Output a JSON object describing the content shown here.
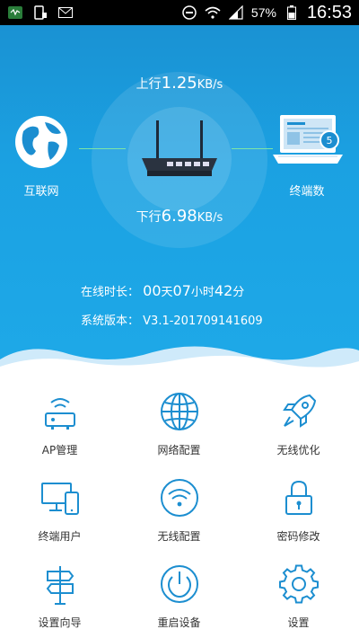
{
  "status_bar": {
    "battery": "57%",
    "time": "16:53"
  },
  "hero": {
    "upload_label": "上行",
    "upload_value": "1.25",
    "upload_unit": "KB/s",
    "download_label": "下行",
    "download_value": "6.98",
    "download_unit": "KB/s",
    "internet_label": "互联网",
    "terminals_label": "终端数",
    "terminals_count": "5",
    "online_label": "在线时长：",
    "online_days": "00",
    "online_days_unit": "天",
    "online_hours": "07",
    "online_hours_unit": "小时",
    "online_minutes": "42",
    "online_minutes_unit": "分",
    "version_label": "系统版本：",
    "version_value": "V3.1-201709141609"
  },
  "menu": {
    "ap": "AP管理",
    "network": "网络配置",
    "wireless_opt": "无线优化",
    "terminal_users": "终端用户",
    "wireless_config": "无线配置",
    "password": "密码修改",
    "wizard": "设置向导",
    "reboot": "重启设备",
    "settings": "设置"
  },
  "colors": {
    "primary": "#1ba1e2",
    "icon": "#1c8ed0",
    "grid_line": "#bfdff3"
  }
}
